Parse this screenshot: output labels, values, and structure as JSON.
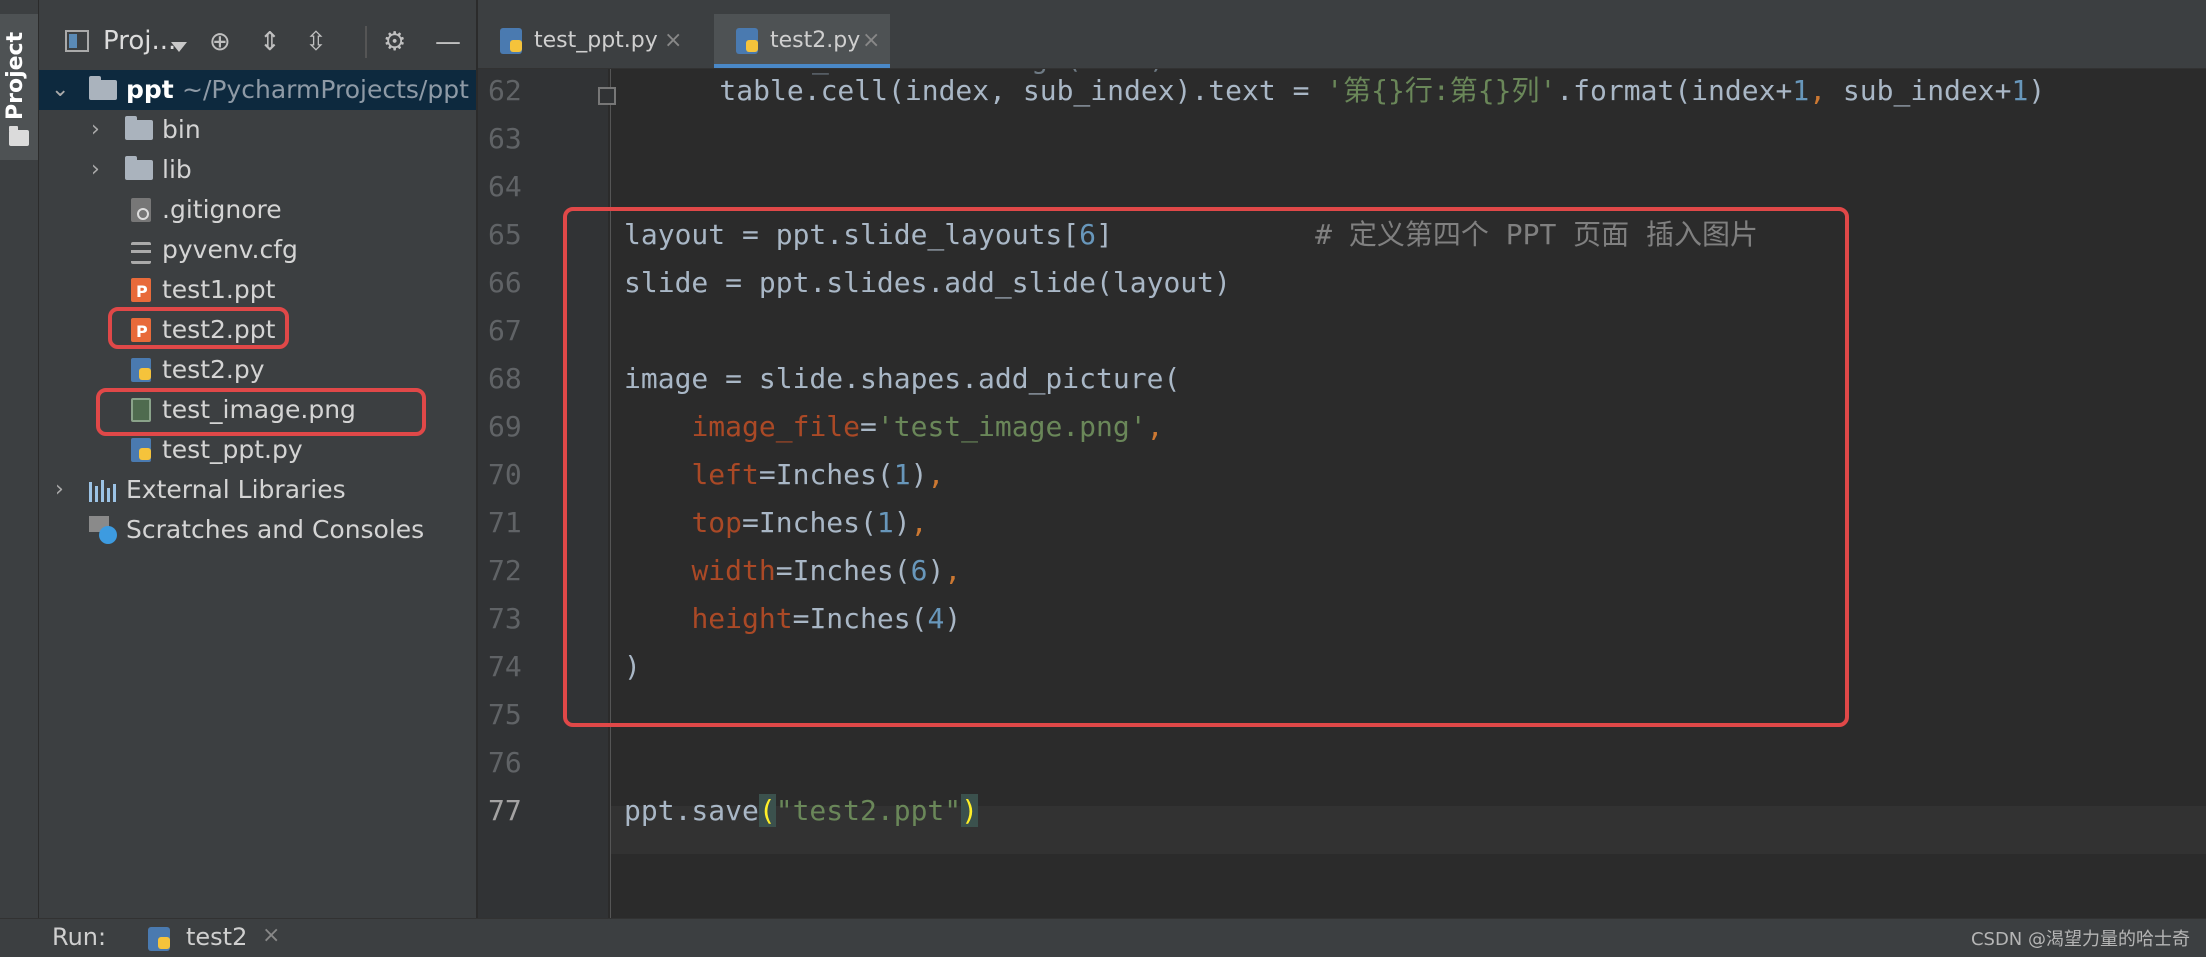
{
  "sidebar_stripe": {
    "label": "Project"
  },
  "project_panel": {
    "title": "Proj...",
    "tree": [
      {
        "name": "ppt",
        "path": "~/PycharmProjects/ppt"
      },
      {
        "name": "bin"
      },
      {
        "name": "lib"
      },
      {
        "name": ".gitignore"
      },
      {
        "name": "pyvenv.cfg"
      },
      {
        "name": "test1.ppt"
      },
      {
        "name": "test2.ppt"
      },
      {
        "name": "test2.py"
      },
      {
        "name": "test_image.png"
      },
      {
        "name": "test_ppt.py"
      },
      {
        "name": "External Libraries"
      },
      {
        "name": "Scratches and Consoles"
      }
    ]
  },
  "editor_tabs": [
    {
      "label": "test_ppt.py",
      "close": "×"
    },
    {
      "label": "test2.py",
      "close": "×"
    }
  ],
  "editor": {
    "line_numbers": [
      "62",
      "63",
      "64",
      "65",
      "66",
      "67",
      "68",
      "69",
      "70",
      "71",
      "72",
      "73",
      "74",
      "75",
      "76",
      "77"
    ],
    "current_line": "77",
    "partial_top_line": "for sub_index in range(cols):"
  },
  "run_bar": {
    "label": "Run:",
    "config": "test2",
    "close": "×"
  },
  "watermark": "CSDN @渴望力量的哈士奇",
  "colors": {
    "highlight_border": "#e04848",
    "keyword": "#cc7832",
    "number": "#6897bb",
    "string": "#6a8759",
    "comment": "#808080",
    "param": "#aa4926"
  }
}
